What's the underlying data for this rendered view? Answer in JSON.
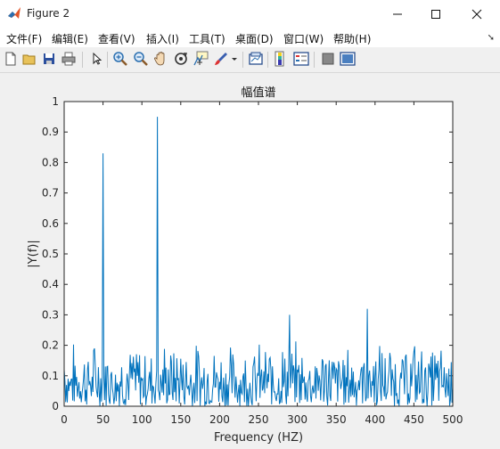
{
  "window": {
    "title": "Figure 2"
  },
  "menu": [
    "文件(F)",
    "编辑(E)",
    "查看(V)",
    "插入(I)",
    "工具(T)",
    "桌面(D)",
    "窗口(W)",
    "帮助(H)"
  ],
  "toolbar_icons": [
    "new-figure-icon",
    "open-file-icon",
    "save-icon",
    "print-icon",
    "pointer-icon",
    "zoom-in-icon",
    "zoom-out-icon",
    "pan-icon",
    "rotate-3d-icon",
    "data-cursor-icon",
    "brush-icon",
    "brush-dropdown-icon",
    "link-plot-icon",
    "colorbar-icon",
    "legend-icon",
    "hide-plot-tools-icon",
    "show-plot-tools-icon"
  ],
  "chart_data": {
    "type": "line",
    "title": "幅值谱",
    "xlabel": "Frequency  (HZ)",
    "ylabel": "|Y(f)|",
    "xlim": [
      0,
      500
    ],
    "ylim": [
      0,
      1
    ],
    "xticks": [
      "0",
      "50",
      "100",
      "150",
      "200",
      "250",
      "300",
      "350",
      "400",
      "450",
      "500"
    ],
    "yticks": [
      "0",
      "0.1",
      "0.2",
      "0.3",
      "0.4",
      "0.5",
      "0.6",
      "0.7",
      "0.8",
      "0.9",
      "1"
    ],
    "grid": false,
    "series": [
      {
        "color": "#0072bd",
        "x": [
          0,
          50,
          120,
          200,
          250,
          290,
          300,
          390,
          400,
          450,
          500
        ],
        "y": [
          0.12,
          0.83,
          0.95,
          0.08,
          0.1,
          0.3,
          0.12,
          0.32,
          0.1,
          0.18,
          0.06
        ]
      }
    ],
    "noise_floor_range": [
      0.0,
      0.22
    ]
  }
}
